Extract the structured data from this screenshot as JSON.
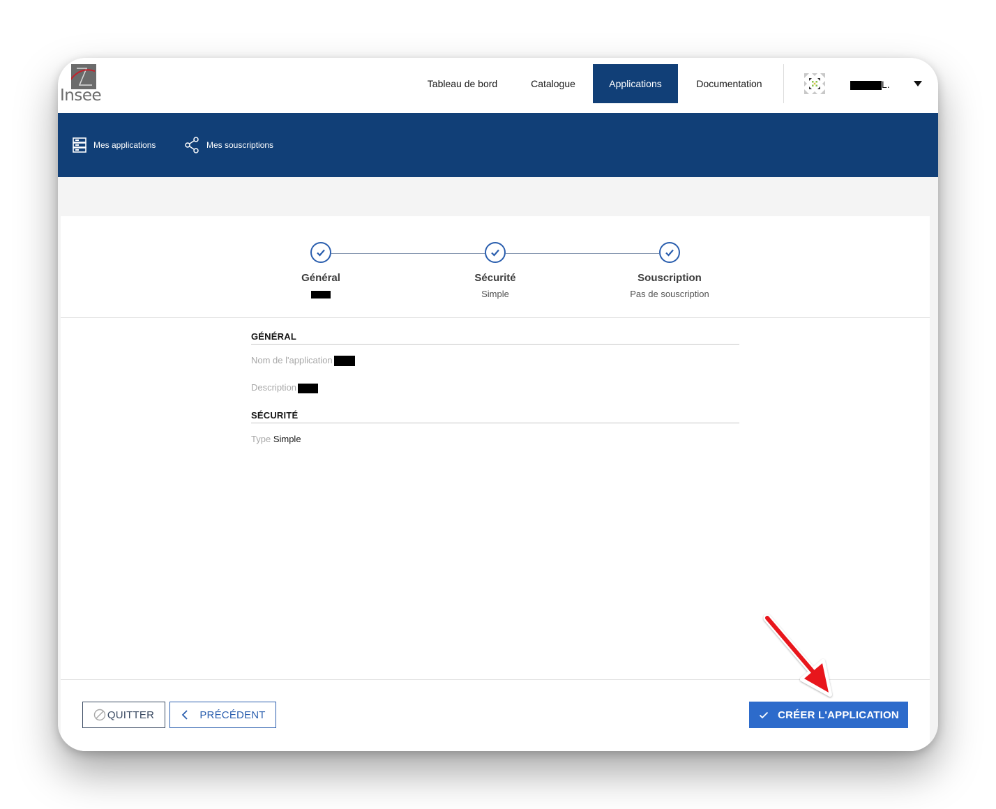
{
  "brand": {
    "logo_text": "Insee"
  },
  "header": {
    "nav": [
      {
        "label": "Tableau de bord",
        "active": false
      },
      {
        "label": "Catalogue",
        "active": false
      },
      {
        "label": "Applications",
        "active": true
      },
      {
        "label": "Documentation",
        "active": false
      }
    ],
    "user_suffix": "L.",
    "avatar_icon": "identicon",
    "dropdown_icon": "caret-down-icon"
  },
  "subnav": {
    "items": [
      {
        "label": "Mes applications",
        "icon": "server-icon"
      },
      {
        "label": "Mes souscriptions",
        "icon": "share-icon"
      }
    ]
  },
  "stepper": {
    "steps": [
      {
        "title": "Général",
        "subtitle": "",
        "status": "complete"
      },
      {
        "title": "Sécurité",
        "subtitle": "Simple",
        "status": "complete"
      },
      {
        "title": "Souscription",
        "subtitle": "Pas de souscription",
        "status": "complete"
      }
    ]
  },
  "summary": {
    "general_title": "GÉNÉRAL",
    "name_label": "Nom de l'application",
    "description_label": "Description",
    "security_title": "SÉCURITÉ",
    "type_label": "Type",
    "type_value": "Simple"
  },
  "actions": {
    "quit_label": "QUITTER",
    "previous_label": "PRÉCÉDENT",
    "create_label": "CRÉER L'APPLICATION"
  },
  "colors": {
    "brand_blue": "#113f77",
    "primary_button": "#2d6bcb",
    "annotation_arrow": "#e8141b"
  }
}
